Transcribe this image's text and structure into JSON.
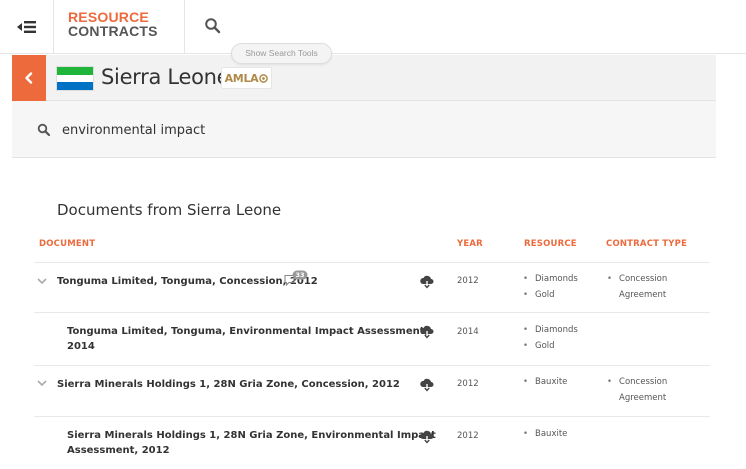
{
  "header": {
    "brand_line1": "RESOURCE",
    "brand_line2": "CONTRACTS",
    "search_tools_label": "Show Search Tools"
  },
  "country": {
    "name": "Sierra Leone",
    "badge": "AMLA",
    "flag_colors": [
      "#1eb53a",
      "#ffffff",
      "#0072c6"
    ]
  },
  "search": {
    "query": "environmental impact",
    "placeholder": ""
  },
  "documents": {
    "title": "Documents from Sierra Leone",
    "columns": {
      "document": "DOCUMENT",
      "year": "YEAR",
      "resource": "RESOURCE",
      "contract_type": "CONTRACT TYPE"
    },
    "rows": [
      {
        "title_line1": "Tonguma Limited, Tonguma, Concession, 2012",
        "title_line2": "",
        "comment_count": "33",
        "year": "2012",
        "resources": [
          "Diamonds",
          "Gold"
        ],
        "contract_types": [
          "Concession",
          "Agreement"
        ]
      },
      {
        "title_line1": "Tonguma Limited, Tonguma, Environmental Impact Assessment,",
        "title_line2": "2014",
        "year": "2014",
        "resources": [
          "Diamonds",
          "Gold"
        ]
      },
      {
        "title_line1": "Sierra Minerals Holdings 1, 28N Gria Zone, Concession, 2012",
        "title_line2": "",
        "year": "2012",
        "resources": [
          "Bauxite"
        ],
        "contract_types": [
          "Concession",
          "Agreement"
        ]
      },
      {
        "title_line1": "Sierra Minerals Holdings 1, 28N Gria Zone, Environmental Impact",
        "title_line2": "Assessment, 2012",
        "year": "2012",
        "resources": [
          "Bauxite"
        ]
      }
    ]
  },
  "icons": {
    "menu": "menu-collapse-icon",
    "search": "search-icon",
    "back": "chevron-left-icon",
    "expand": "chevron-down-icon",
    "download": "cloud-download-icon",
    "comment": "comment-icon"
  },
  "colors": {
    "accent": "#ec6a3c",
    "badge_text": "#b08a48"
  }
}
